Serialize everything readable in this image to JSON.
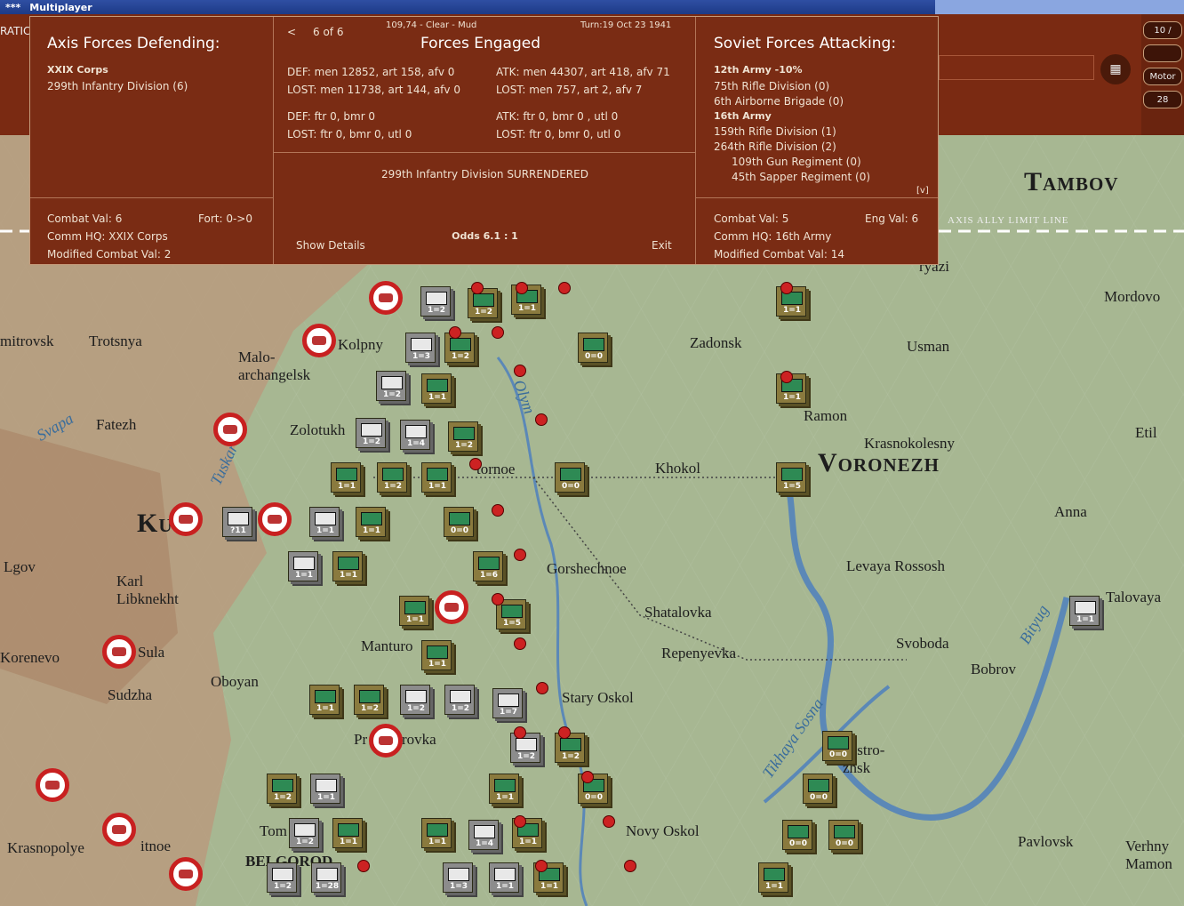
{
  "window": {
    "title_icon": "***",
    "title": "Multiplayer"
  },
  "toolbar": {
    "left_text": "RATIC",
    "pills": [
      "10 /",
      "",
      "Motor",
      "28"
    ],
    "stack_icon": "stack-icon"
  },
  "map": {
    "towns": [
      {
        "name": "Trotsnya"
      },
      {
        "name": "Malo-"
      },
      {
        "name": "archangelsk"
      },
      {
        "name": "Kolpny"
      },
      {
        "name": "Zadonsk"
      },
      {
        "name": "Usman"
      },
      {
        "name": "Mordovo"
      },
      {
        "name": "Fatezh"
      },
      {
        "name": "Zolotukh"
      },
      {
        "name": "Ramon"
      },
      {
        "name": "Krasnokolesny"
      },
      {
        "name": "Etil"
      },
      {
        "name": "Khokol"
      },
      {
        "name": "Voronezh"
      },
      {
        "name": "Anna"
      },
      {
        "name": "Tambov"
      },
      {
        "name": "Gorshechnoe"
      },
      {
        "name": "Levaya Rossosh"
      },
      {
        "name": "Karl"
      },
      {
        "name": "Libknekht"
      },
      {
        "name": "Shatalovka"
      },
      {
        "name": "Talovaya"
      },
      {
        "name": "Sula"
      },
      {
        "name": "Manturo"
      },
      {
        "name": "Repenyevka"
      },
      {
        "name": "Svoboda"
      },
      {
        "name": "Bobrov"
      },
      {
        "name": "Korenevo"
      },
      {
        "name": "Oboyan"
      },
      {
        "name": "Sudzha"
      },
      {
        "name": "Stary Oskol"
      },
      {
        "name": "Pavlovsk"
      },
      {
        "name": "Novy Oskol"
      },
      {
        "name": "Krasnopolye"
      },
      {
        "name": "Verhny"
      },
      {
        "name": "Mamon"
      },
      {
        "name": "Lgov"
      },
      {
        "name": "Ku"
      },
      {
        "name": "Tom"
      },
      {
        "name": "BELGOROD"
      },
      {
        "name": "Ostro-"
      },
      {
        "name": "zhsk"
      },
      {
        "name": "rovka"
      },
      {
        "name": "Pr"
      },
      {
        "name": "itnoe"
      },
      {
        "name": "ryazi"
      },
      {
        "name": "mitrovsk"
      },
      {
        "name": "tornoe"
      }
    ],
    "rivers": [
      "Tuskar",
      "Svapa",
      "Olym",
      "Tikhaya Sosna",
      "Bityug"
    ],
    "limit_line_label": "AXIS ALLY LIMIT LINE",
    "counter_values": [
      "1=2",
      "1=3",
      "1=2",
      "1=1",
      "1=2",
      "0=0",
      "1=1",
      "1=2",
      "1=1",
      "1=1",
      "1=2",
      "1=4",
      "1=2",
      "1=1",
      "1=2",
      "1=1",
      "0=0",
      "1=5",
      "1=1",
      "1=1",
      "0=0",
      "1=1",
      "1=1",
      "1=6",
      "1=5",
      "1=1",
      "1=1",
      "1=2",
      "1=2",
      "1=7",
      "1=2",
      "1=2",
      "1=1",
      "1=2",
      "1=2",
      "1=1",
      "1=1",
      "0=0",
      "0=0",
      "0=0",
      "1=2",
      "1=1",
      "1=1",
      "1=4",
      "1=1",
      "1=2",
      "1=28",
      "1=3",
      "1=1",
      "1=1",
      "1=1",
      "0=0",
      "0=0",
      "?11",
      "1=1"
    ]
  },
  "dialog": {
    "axis": {
      "title": "Axis Forces Defending:",
      "corps": "XXIX Corps",
      "units": [
        "299th Infantry Division (6)"
      ],
      "combat_val": "Combat Val: 6",
      "fort": "Fort: 0->0",
      "comm_hq": "Comm HQ: XXIX Corps",
      "modified": "Modified Combat Val: 2"
    },
    "engaged": {
      "nav_prev": "<",
      "page": "6 of 6",
      "hex_info": "109,74 - Clear - Mud",
      "turn": "Turn:19  Oct 23 1941",
      "title": "Forces Engaged",
      "def_line": "DEF: men 12852, art 158, afv 0",
      "def_lost": "LOST: men 11738, art 144, afv 0",
      "atk_line": "ATK: men 44307, art 418, afv 71",
      "atk_lost": "LOST: men 757, art 2, afv 7",
      "def_air": "DEF: ftr 0, bmr 0",
      "def_air_lost": "LOST: ftr 0, bmr 0, utl 0",
      "atk_air": "ATK: ftr 0, bmr 0 , utl 0",
      "atk_air_lost": "LOST: ftr 0, bmr 0, utl 0",
      "result": "299th Infantry Division SURRENDERED",
      "show_details": "Show Details",
      "odds": "Odds 6.1 : 1",
      "exit": "Exit"
    },
    "soviet": {
      "title": "Soviet Forces Attacking:",
      "army1": "12th Army  -10%",
      "army1_units": [
        "75th Rifle Division (0)",
        "6th Airborne Brigade (0)"
      ],
      "army2": "16th Army",
      "army2_units": [
        "159th Rifle Division (1)",
        "264th Rifle Division (2)"
      ],
      "army2_sub": [
        "109th Gun Regiment (0)",
        "45th Sapper Regiment (0)"
      ],
      "expand": "[v]",
      "combat_val": "Combat Val: 5",
      "eng_val": "Eng Val: 6",
      "comm_hq": "Comm HQ: 16th Army",
      "modified": "Modified Combat Val: 14"
    }
  },
  "colors": {
    "dialog_bg": "#7a2c14",
    "soviet_counter": "#8a7a3e",
    "axis_counter": "#8c8c8c",
    "map_bg": "#a7b792"
  }
}
